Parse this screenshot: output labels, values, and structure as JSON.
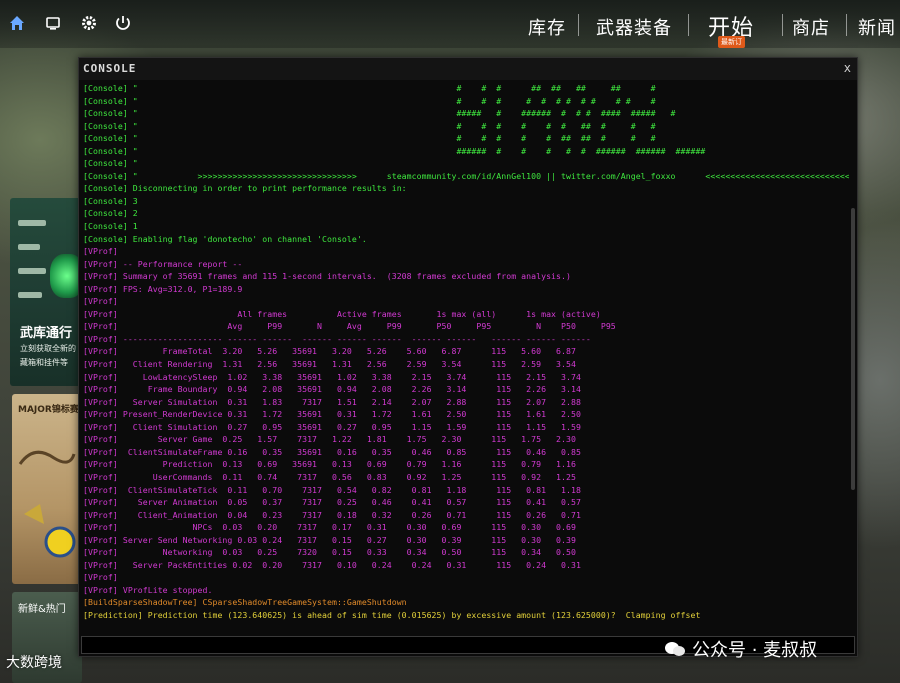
{
  "topbar": {
    "nav": [
      {
        "label": "库存"
      },
      {
        "label": "武器装备"
      },
      {
        "label": "开始",
        "badge": "最新订"
      },
      {
        "label": "商店"
      },
      {
        "label": "新闻"
      }
    ]
  },
  "promos": {
    "armory_title": "武库通行",
    "armory_sub": "立刻获取全新的 ... 藏箱和挂件等",
    "major_title": "MAJOR锦标赛",
    "fresh_title": "新鲜&热门"
  },
  "watermark": "公众号 · 麦叔叔",
  "bottom_logo": "大数跨境",
  "console": {
    "title": "CONSOLE",
    "close": "x",
    "input_value": "",
    "lines": [
      {
        "text": "[Console] \"                                                                #    #  #      ##  ##   ##     ##      #",
        "kind": "console"
      },
      {
        "text": "[Console] \"                                                                #    #  #     #  #  # #  # #    # #    #",
        "kind": "console"
      },
      {
        "text": "[Console] \"                                                                #####   #    ######  #  # #  ####  #####   #",
        "kind": "console"
      },
      {
        "text": "[Console] \"                                                                #    #  #    #    #  #   ##  #     #   #",
        "kind": "console"
      },
      {
        "text": "[Console] \"                                                                #    #  #    #    #  ##  ##  #     #   #",
        "kind": "console"
      },
      {
        "text": "[Console] \"                                                                ######  #    #    #   #  #  ######  ######  ######",
        "kind": "console"
      },
      {
        "text": "[Console] \"",
        "kind": "console"
      },
      {
        "text": "[Console] \"            >>>>>>>>>>>>>>>>>>>>>>>>>>>>>>>>      steamcommunity.com/id/AnnGel100 || twitter.com/Angel_foxxo      <<<<<<<<<<<<<<<<<<<<<<<<<<<<<<<<",
        "kind": "console"
      },
      {
        "text": "[Console] Disconnecting in order to print performance results in:",
        "kind": "console"
      },
      {
        "text": "[Console] 3",
        "kind": "console"
      },
      {
        "text": "[Console] 2",
        "kind": "console"
      },
      {
        "text": "[Console] 1",
        "kind": "console"
      },
      {
        "text": "[Console] Enabling flag 'donotecho' on channel 'Console'.",
        "kind": "console"
      },
      {
        "text": "[VProf]",
        "kind": "vprof"
      },
      {
        "text": "[VProf] -- Performance report --",
        "kind": "vprof"
      },
      {
        "text": "[VProf] Summary of 35691 frames and 115 1-second intervals.  (3208 frames excluded from analysis.)",
        "kind": "vprof"
      },
      {
        "text": "[VProf] FPS: Avg=312.0, P1=189.9",
        "kind": "vprof"
      },
      {
        "text": "[VProf]",
        "kind": "vprof"
      },
      {
        "text": "[VProf]                        All frames          Active frames       1s max (all)      1s max (active)",
        "kind": "vprof"
      },
      {
        "text": "[VProf]                      Avg     P99       N     Avg     P99       P50     P95         N    P50     P95",
        "kind": "vprof"
      },
      {
        "text": "[VProf] -------------------- ------ ------  ------ ------ ------  ------ ------   ------ ------ ------",
        "kind": "vprof"
      },
      {
        "text": "[VProf]         FrameTotal  3.20   5.26   35691   3.20   5.26    5.60   6.87      115   5.60   6.87",
        "kind": "vprof"
      },
      {
        "text": "[VProf]   Client Rendering  1.31   2.56   35691   1.31   2.56    2.59   3.54      115   2.59   3.54",
        "kind": "vprof"
      },
      {
        "text": "[VProf]     LowLatencySleep  1.02   3.38   35691   1.02   3.38    2.15   3.74      115   2.15   3.74",
        "kind": "vprof"
      },
      {
        "text": "[VProf]      Frame Boundary  0.94   2.08   35691   0.94   2.08    2.26   3.14      115   2.26   3.14",
        "kind": "vprof"
      },
      {
        "text": "[VProf]   Server Simulation  0.31   1.83    7317   1.51   2.14    2.07   2.88      115   2.07   2.88",
        "kind": "vprof"
      },
      {
        "text": "[VProf] Present_RenderDevice 0.31   1.72   35691   0.31   1.72    1.61   2.50      115   1.61   2.50",
        "kind": "vprof"
      },
      {
        "text": "[VProf]   Client Simulation  0.27   0.95   35691   0.27   0.95    1.15   1.59      115   1.15   1.59",
        "kind": "vprof"
      },
      {
        "text": "[VProf]        Server Game  0.25   1.57    7317   1.22   1.81    1.75   2.30      115   1.75   2.30",
        "kind": "vprof"
      },
      {
        "text": "[VProf]  ClientSimulateFrame 0.16   0.35   35691   0.16   0.35    0.46   0.85      115   0.46   0.85",
        "kind": "vprof"
      },
      {
        "text": "[VProf]         Prediction  0.13   0.69   35691   0.13   0.69    0.79   1.16      115   0.79   1.16",
        "kind": "vprof"
      },
      {
        "text": "[VProf]       UserCommands  0.11   0.74    7317   0.56   0.83    0.92   1.25      115   0.92   1.25",
        "kind": "vprof"
      },
      {
        "text": "[VProf]  ClientSimulateTick  0.11   0.70    7317   0.54   0.82    0.81   1.18      115   0.81   1.18",
        "kind": "vprof"
      },
      {
        "text": "[VProf]    Server Animation  0.05   0.37    7317   0.25   0.46    0.41   0.57      115   0.41   0.57",
        "kind": "vprof"
      },
      {
        "text": "[VProf]    Client_Animation  0.04   0.23    7317   0.18   0.32    0.26   0.71      115   0.26   0.71",
        "kind": "vprof"
      },
      {
        "text": "[VProf]               NPCs  0.03   0.20    7317   0.17   0.31    0.30   0.69      115   0.30   0.69",
        "kind": "vprof"
      },
      {
        "text": "[VProf] Server Send Networking 0.03 0.24   7317   0.15   0.27    0.30   0.39      115   0.30   0.39",
        "kind": "vprof"
      },
      {
        "text": "[VProf]         Networking  0.03   0.25    7320   0.15   0.33    0.34   0.50      115   0.34   0.50",
        "kind": "vprof"
      },
      {
        "text": "[VProf]   Server PackEntities 0.02  0.20    7317   0.10   0.24    0.24   0.31      115   0.24   0.31",
        "kind": "vprof"
      },
      {
        "text": "[VProf]",
        "kind": "vprof"
      },
      {
        "text": "[VProf] VProfLite stopped.",
        "kind": "vprof"
      },
      {
        "text": "[BuildSparseShadowTree] CSparseShadowTreeGameSystem::GameShutdown",
        "kind": "build"
      },
      {
        "text": "[Prediction] Prediction time (123.640625) is ahead of sim time (0.015625) by excessive amount (123.625000)?  Clamping offset",
        "kind": "pred"
      }
    ]
  }
}
